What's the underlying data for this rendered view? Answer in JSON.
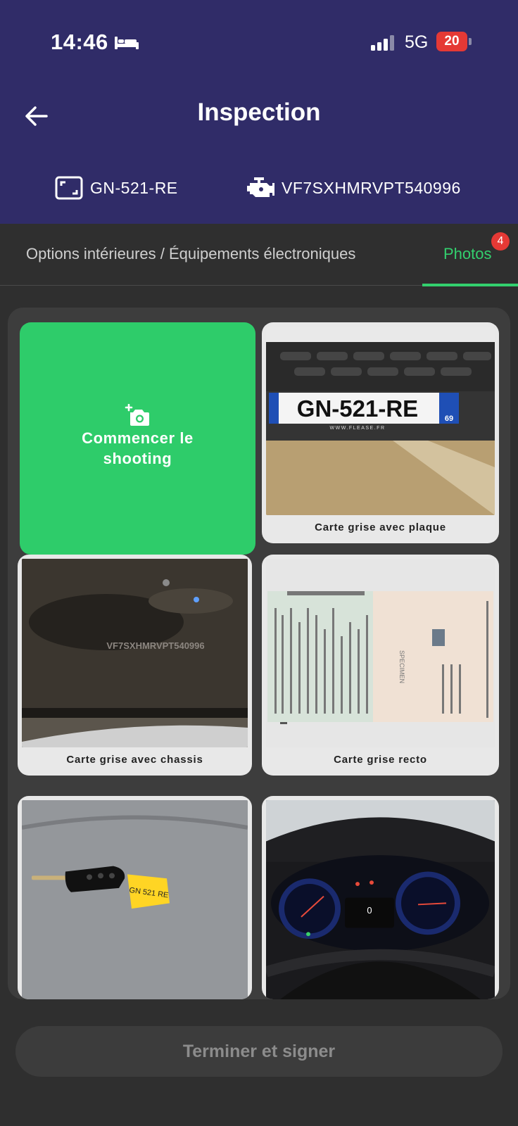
{
  "status_bar": {
    "time": "14:46",
    "network": "5G",
    "battery": "20"
  },
  "header": {
    "title": "Inspection",
    "plate": "GN-521-RE",
    "vin": "VF7SXHMRVPT540996"
  },
  "tabs": {
    "options_label": "Options intérieures / Équipements électroniques",
    "photos_label": "Photos",
    "photos_badge": "4"
  },
  "grid": {
    "start_label": "Commencer le\nshooting",
    "cards": [
      {
        "label": "Carte grise avec plaque",
        "photo_text": "GN-521-RE",
        "plate_dept": "69",
        "plate_site": "WWW.FLEASE.FR"
      },
      {
        "label": "Carte grise avec chassis",
        "photo_text": "VF7SXHMRVPT540996"
      },
      {
        "label": "Carte grise recto",
        "photo_text": "SPECIMEN"
      },
      {
        "label": "",
        "photo_text": "GN 521 RE"
      },
      {
        "label": "",
        "photo_text": "0"
      }
    ]
  },
  "footer": {
    "finish_label": "Terminer et signer"
  },
  "colors": {
    "header_bg": "#302c68",
    "accent_green": "#33d06e",
    "badge_red": "#e53935"
  }
}
